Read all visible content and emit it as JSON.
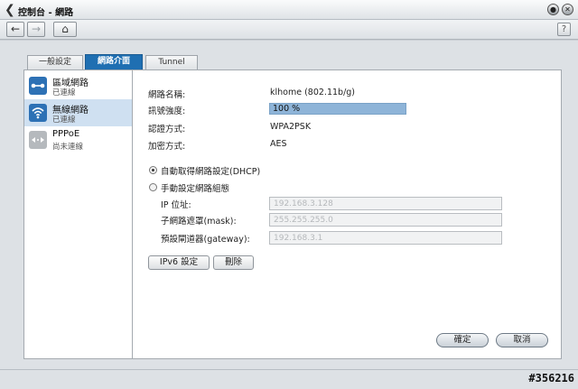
{
  "window": {
    "title": "控制台 - 網路",
    "close_symbol": "✕",
    "help_symbol": "?"
  },
  "toolbar": {
    "back_symbol": "←",
    "forward_symbol": "→",
    "home_symbol": "⌂"
  },
  "tabs": [
    {
      "label": "一般設定",
      "active": false
    },
    {
      "label": "網路介面",
      "active": true
    },
    {
      "label": "Tunnel",
      "active": false
    }
  ],
  "interfaces": [
    {
      "name": "區域網路",
      "status": "已連線",
      "icon": "lan-icon",
      "selected": false
    },
    {
      "name": "無線網路",
      "status": "已連線",
      "icon": "wifi-icon",
      "selected": true
    },
    {
      "name": "PPPoE",
      "status": "尚未連線",
      "icon": "pppoe-icon",
      "selected": false
    }
  ],
  "wireless": {
    "ssid_label": "網路名稱:",
    "ssid_value": "klhome (802.11b/g)",
    "signal_label": "訊號強度:",
    "signal_value": "100 %",
    "signal_level": 1.0,
    "auth_label": "認證方式:",
    "auth_value": "WPA2PSK",
    "encrypt_label": "加密方式:",
    "encrypt_value": "AES"
  },
  "ip_config": {
    "dhcp_label": "自動取得網路設定(DHCP)",
    "dhcp_selected": true,
    "manual_label": "手動設定網路組態",
    "ip_label": "IP 位址:",
    "ip_value": "192.168.3.128",
    "mask_label": "子網路遮罩(mask):",
    "mask_value": "255.255.255.0",
    "gateway_label": "預設閘道器(gateway):",
    "gateway_value": "192.168.3.1"
  },
  "buttons": {
    "ipv6": "IPv6 設定",
    "delete": "刪除",
    "ok": "確定",
    "cancel": "取消"
  },
  "watermark": "#356216"
}
